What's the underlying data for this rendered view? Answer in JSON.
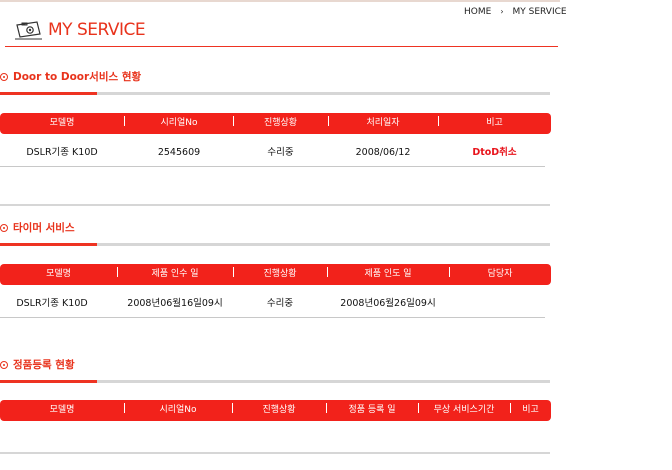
{
  "breadcrumb": {
    "home": "HOME",
    "separator": "›",
    "current": "MY SERVICE"
  },
  "page_title": "MY SERVICE",
  "title_icon": "camera-icon",
  "colors": {
    "accent": "#f2221b",
    "title": "#e8331c",
    "rule": "#d6d6d6"
  },
  "sections": {
    "door": {
      "title": "Door to Door서비스 현황",
      "headers": [
        "모델명",
        "시리얼No",
        "진행상황",
        "처리일자",
        "비고"
      ],
      "rows": [
        [
          "DSLR기종 K10D",
          "2545609",
          "수리중",
          "2008/06/12",
          "DtoD취소"
        ]
      ]
    },
    "timer": {
      "title": "타이머 서비스",
      "headers": [
        "모델명",
        "제품 인수 일",
        "진행상황",
        "제품 인도 일",
        "담당자"
      ],
      "rows": [
        [
          "DSLR기종 K10D",
          "2008년06월16일09시",
          "수리중",
          "2008년06월26일09시",
          ""
        ]
      ]
    },
    "reg": {
      "title": "정품등록 현황",
      "headers": [
        "모델명",
        "시리얼No",
        "진행상황",
        "정품 등록 일",
        "무상 서비스기간",
        "비고"
      ]
    }
  }
}
